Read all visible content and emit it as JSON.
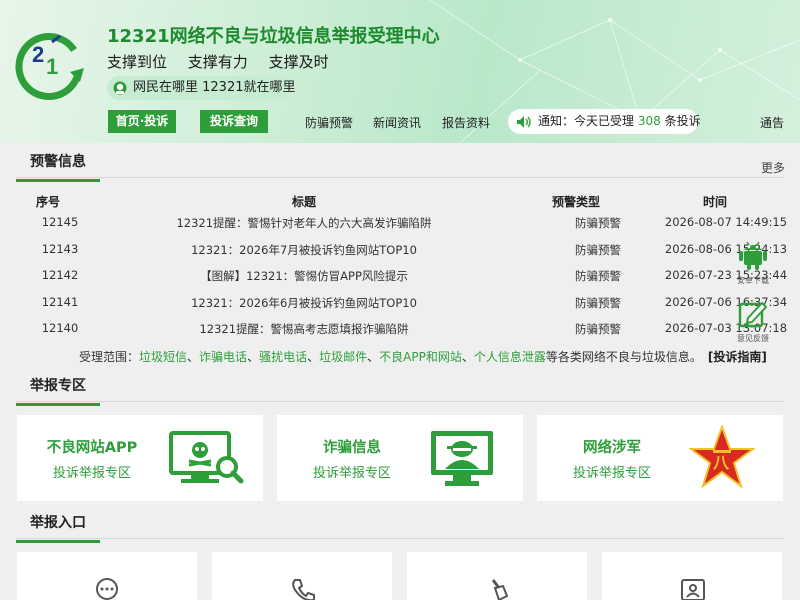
{
  "header": {
    "site_title": "12321网络不良与垃圾信息举报受理中心",
    "slogans": [
      "支撑到位",
      "支撑有力",
      "支撑及时"
    ],
    "pill_text": "网民在哪里 12321就在哪里",
    "buttons": [
      "首页·投诉",
      "投诉查询"
    ],
    "nav_links": [
      "防骗预警",
      "新闻资讯",
      "报告资料"
    ],
    "notice": {
      "prefix": "通知：今天已受理",
      "count": "308",
      "suffix": "条投诉",
      "more": "通告"
    }
  },
  "warnings": {
    "title": "预警信息",
    "more": "更多",
    "columns": [
      "序号",
      "标题",
      "预警类型",
      "时间"
    ],
    "rows": [
      {
        "id": "12145",
        "title": "12321提醒：警惕针对老年人的六大高发诈骗陷阱",
        "type": "防骗预警",
        "time": "2026-08-07 14:49:15"
      },
      {
        "id": "12143",
        "title": "12321：2026年7月被投诉钓鱼网站TOP10",
        "type": "防骗预警",
        "time": "2026-08-06 15:24:13"
      },
      {
        "id": "12142",
        "title": "【图解】12321：警惕仿冒APP风险提示",
        "type": "防骗预警",
        "time": "2026-07-23 15:23:44"
      },
      {
        "id": "12141",
        "title": "12321：2026年6月被投诉钓鱼网站TOP10",
        "type": "防骗预警",
        "time": "2026-07-06 16:37:34"
      },
      {
        "id": "12140",
        "title": "12321提醒：警惕高考志愿填报诈骗陷阱",
        "type": "防骗预警",
        "time": "2026-07-03 13:07:18"
      }
    ]
  },
  "scope": {
    "prefix": "受理范围：",
    "items": [
      "垃圾短信",
      "诈骗电话",
      "骚扰电话",
      "垃圾邮件",
      "不良APP和网站",
      "个人信息泄露"
    ],
    "suffix": "等各类网络不良与垃圾信息。",
    "guide": "[投诉指南]"
  },
  "report_zone": {
    "title": "举报专区",
    "cards": [
      {
        "name": "不良网站APP",
        "sub": "投诉举报专区",
        "icon": "monitor-skull-search-icon"
      },
      {
        "name": "诈骗信息",
        "sub": "投诉举报专区",
        "icon": "monitor-hacker-icon"
      },
      {
        "name": "网络涉军",
        "sub": "投诉举报专区",
        "icon": "army-star-icon"
      }
    ]
  },
  "report_entry": {
    "title": "举报入口",
    "icons": [
      "chat-bubble-icon",
      "phone-icon",
      "broom-icon",
      "id-card-icon"
    ]
  },
  "floating": {
    "android_label": "安卓下载",
    "feedback_label": "意见反馈"
  },
  "colors": {
    "accent": "#2e9e3b",
    "red": "#d82a20"
  }
}
